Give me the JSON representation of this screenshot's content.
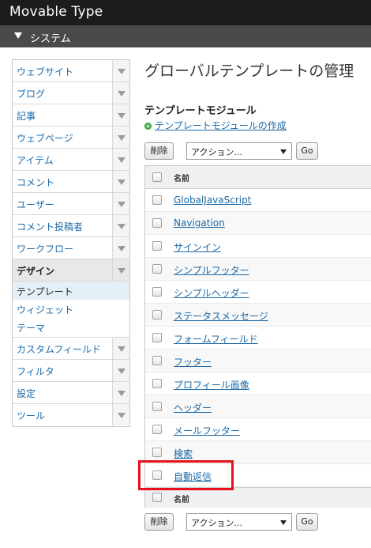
{
  "app": {
    "title": "Movable Type"
  },
  "scope": {
    "label": "システム"
  },
  "sidebar": {
    "items": [
      {
        "label": "ウェブサイト"
      },
      {
        "label": "ブログ"
      },
      {
        "label": "記事"
      },
      {
        "label": "ウェブページ"
      },
      {
        "label": "アイテム"
      },
      {
        "label": "コメント"
      },
      {
        "label": "ユーザー"
      },
      {
        "label": "コメント投稿者"
      },
      {
        "label": "ワークフロー"
      },
      {
        "label": "デザイン"
      },
      {
        "label": "カスタムフィールド"
      },
      {
        "label": "フィルタ"
      },
      {
        "label": "設定"
      },
      {
        "label": "ツール"
      }
    ],
    "design_sub": [
      {
        "label": "テンプレート"
      },
      {
        "label": "ウィジェット"
      },
      {
        "label": "テーマ"
      }
    ]
  },
  "main": {
    "page_title": "グローバルテンプレートの管理",
    "section_title": "テンプレートモジュール",
    "create_link": "テンプレートモジュールの作成",
    "delete_button": "削除",
    "action_select": "アクション...",
    "go_button": "Go",
    "column_name": "名前",
    "rows": [
      {
        "name": "GlobalJavaScript"
      },
      {
        "name": "Navigation"
      },
      {
        "name": "サインイン"
      },
      {
        "name": "シンプルフッター"
      },
      {
        "name": "シンプルヘッダー"
      },
      {
        "name": "ステータスメッセージ"
      },
      {
        "name": "フォームフィールド"
      },
      {
        "name": "フッター"
      },
      {
        "name": "プロフィール画像"
      },
      {
        "name": "ヘッダー"
      },
      {
        "name": "メールフッター"
      },
      {
        "name": "検索"
      },
      {
        "name": "自動返信"
      }
    ]
  },
  "colors": {
    "accent": "#1b6aa8",
    "highlight": "#e8101a",
    "topbar": "#1c1c1c",
    "scopebar": "#4a4a4a"
  }
}
